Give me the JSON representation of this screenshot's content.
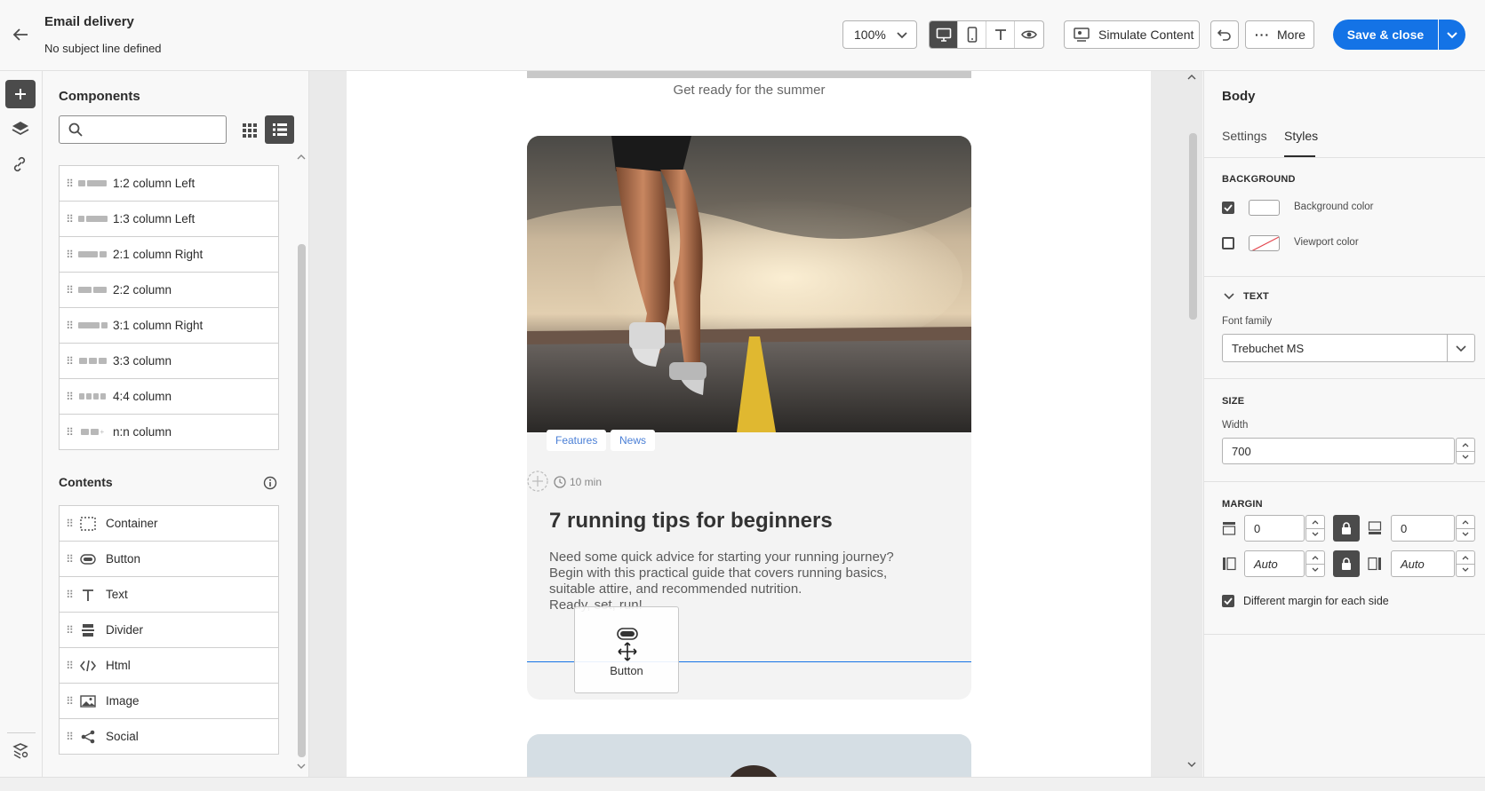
{
  "header": {
    "title": "Email delivery",
    "subtitle": "No subject line defined",
    "zoom": "100%",
    "simulate_label": "Simulate Content",
    "more_label": "More",
    "save_label": "Save & close"
  },
  "components": {
    "title": "Components",
    "search_placeholder": "",
    "structures": [
      {
        "label": "1:2 column Left"
      },
      {
        "label": "1:3 column Left"
      },
      {
        "label": "2:1 column Right"
      },
      {
        "label": "2:2 column"
      },
      {
        "label": "3:1 column Right"
      },
      {
        "label": "3:3 column"
      },
      {
        "label": "4:4 column"
      },
      {
        "label": "n:n column"
      }
    ],
    "contents_title": "Contents",
    "contents": [
      {
        "label": "Container"
      },
      {
        "label": "Button"
      },
      {
        "label": "Text"
      },
      {
        "label": "Divider"
      },
      {
        "label": "Html"
      },
      {
        "label": "Image"
      },
      {
        "label": "Social"
      }
    ]
  },
  "canvas": {
    "tagline": "Get ready for the summer",
    "tags": [
      "Features",
      "News"
    ],
    "read_time": "10 min",
    "article_title": "7 running tips for beginners",
    "article_body_1": "Need some quick advice for starting your running journey?",
    "article_body_2": "Begin with this practical guide that covers running basics,",
    "article_body_3": "suitable attire, and recommended nutrition.",
    "article_body_4": "Ready, set, run!",
    "drag_label": "Button"
  },
  "properties": {
    "title": "Body",
    "tabs": [
      "Settings",
      "Styles"
    ],
    "active_tab": "Styles",
    "background_title": "BACKGROUND",
    "bg_color_label": "Background color",
    "viewport_color_label": "Viewport color",
    "text_title": "TEXT",
    "font_family_label": "Font family",
    "font_family_value": "Trebuchet MS",
    "size_title": "SIZE",
    "width_label": "Width",
    "width_value": "700",
    "margin_title": "MARGIN",
    "margin_top": "0",
    "margin_bottom": "0",
    "margin_left": "Auto",
    "margin_right": "Auto",
    "diff_margin_label": "Different margin for each side"
  },
  "colors": {
    "accent": "#1473e6",
    "tag_text": "#4a7fd6"
  }
}
